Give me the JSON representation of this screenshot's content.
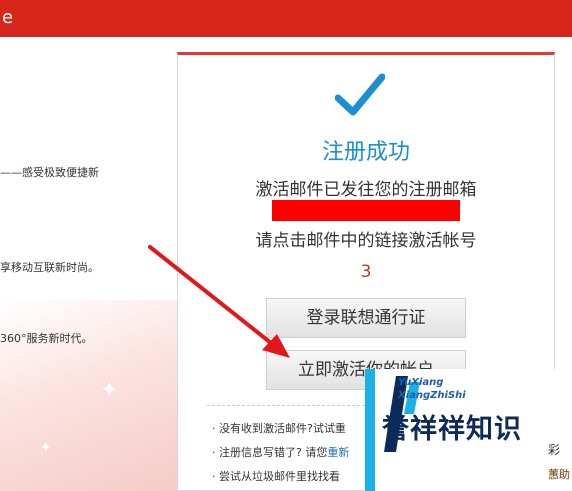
{
  "header": {
    "title_fragment": "e"
  },
  "promo_lines": [
    "——感受极致便捷新",
    "享移动互联新时尚。",
    "360°服务新时代。"
  ],
  "panel": {
    "success_title": "注册成功",
    "line1": "激活邮件已发往您的注册邮箱",
    "line2": "请点击邮件中的链接激活帐号",
    "countdown": "3",
    "login_button": "登录联想通行证",
    "activate_button": "立即激活你的帐户",
    "help": [
      {
        "bullet": "·",
        "text": "没有收到激活邮件?试试重",
        "link": ""
      },
      {
        "bullet": "·",
        "text": "注册信息写错了? 请您",
        "link": "重新"
      },
      {
        "bullet": "·",
        "text": "尝试从垃圾邮件里找找看",
        "link": ""
      }
    ]
  },
  "watermark": {
    "line_small1": "YuXiang",
    "line_small2": "XiangZhiShi",
    "brand": "誉祥祥知识",
    "frag1": "彩",
    "frag2": "蕙助"
  },
  "colors": {
    "header_red": "#d9261c",
    "accent_blue": "#1c8fce",
    "arrow_red": "#e3161b",
    "redaction": "#ff0000"
  },
  "icons": {
    "check": "check-icon",
    "arrow": "annotation-arrow"
  }
}
